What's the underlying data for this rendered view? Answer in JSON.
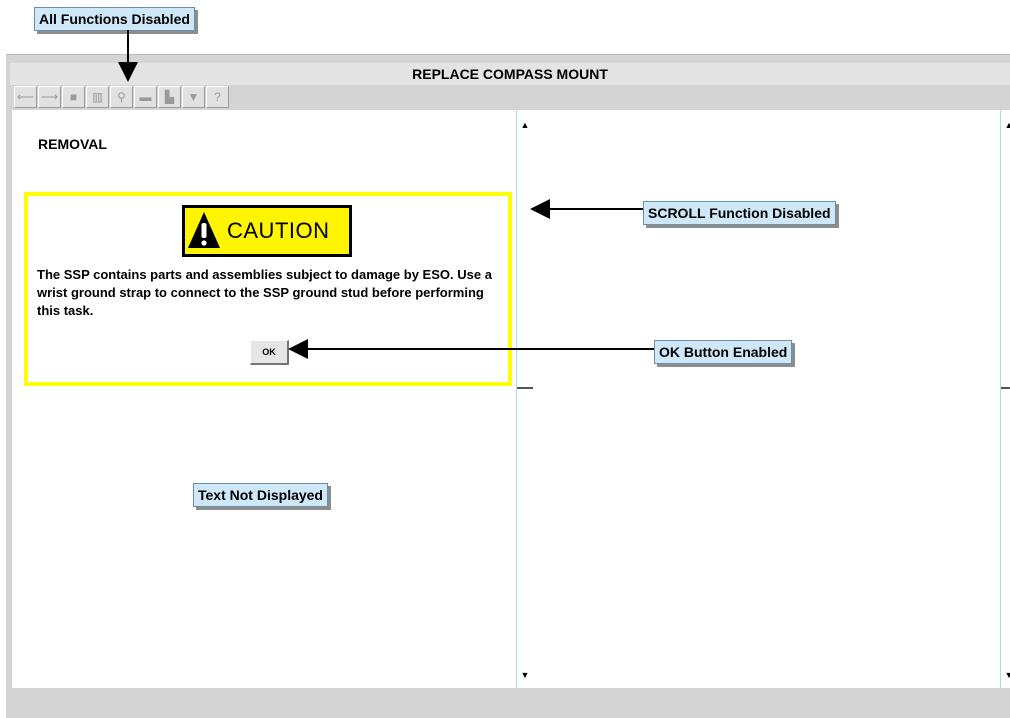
{
  "callouts": {
    "all_functions": "All Functions Disabled",
    "scroll": "SCROLL Function Disabled",
    "ok": "OK Button Enabled",
    "text_not_displayed": "Text Not Displayed"
  },
  "window": {
    "title": "REPLACE COMPASS MOUNT"
  },
  "toolbar": {
    "buttons": [
      {
        "icon": "back-arrow-icon",
        "glyph": "⟵"
      },
      {
        "icon": "forward-arrow-icon",
        "glyph": "⟶"
      },
      {
        "icon": "page-icon",
        "glyph": "■"
      },
      {
        "icon": "index-icon",
        "glyph": "▥"
      },
      {
        "icon": "binoculars-icon",
        "glyph": "⚲"
      },
      {
        "icon": "print-icon",
        "glyph": "▬"
      },
      {
        "icon": "tools-icon",
        "glyph": "▙"
      },
      {
        "icon": "bookmark-icon",
        "glyph": "▼"
      },
      {
        "icon": "help-icon",
        "glyph": "?"
      }
    ],
    "state": "disabled"
  },
  "content": {
    "heading": "REMOVAL",
    "caution_label": "CAUTION",
    "caution_text": "The SSP contains parts and assemblies subject to damage by ESO. Use a wrist ground strap to connect to the SSP ground stud before performing this task.",
    "ok_label": "OK"
  },
  "colors": {
    "callout_bg": "#cfe8f9",
    "caution_border": "#ffff00",
    "caution_sign": "#fff500",
    "window_gray": "#d4d4d4"
  }
}
